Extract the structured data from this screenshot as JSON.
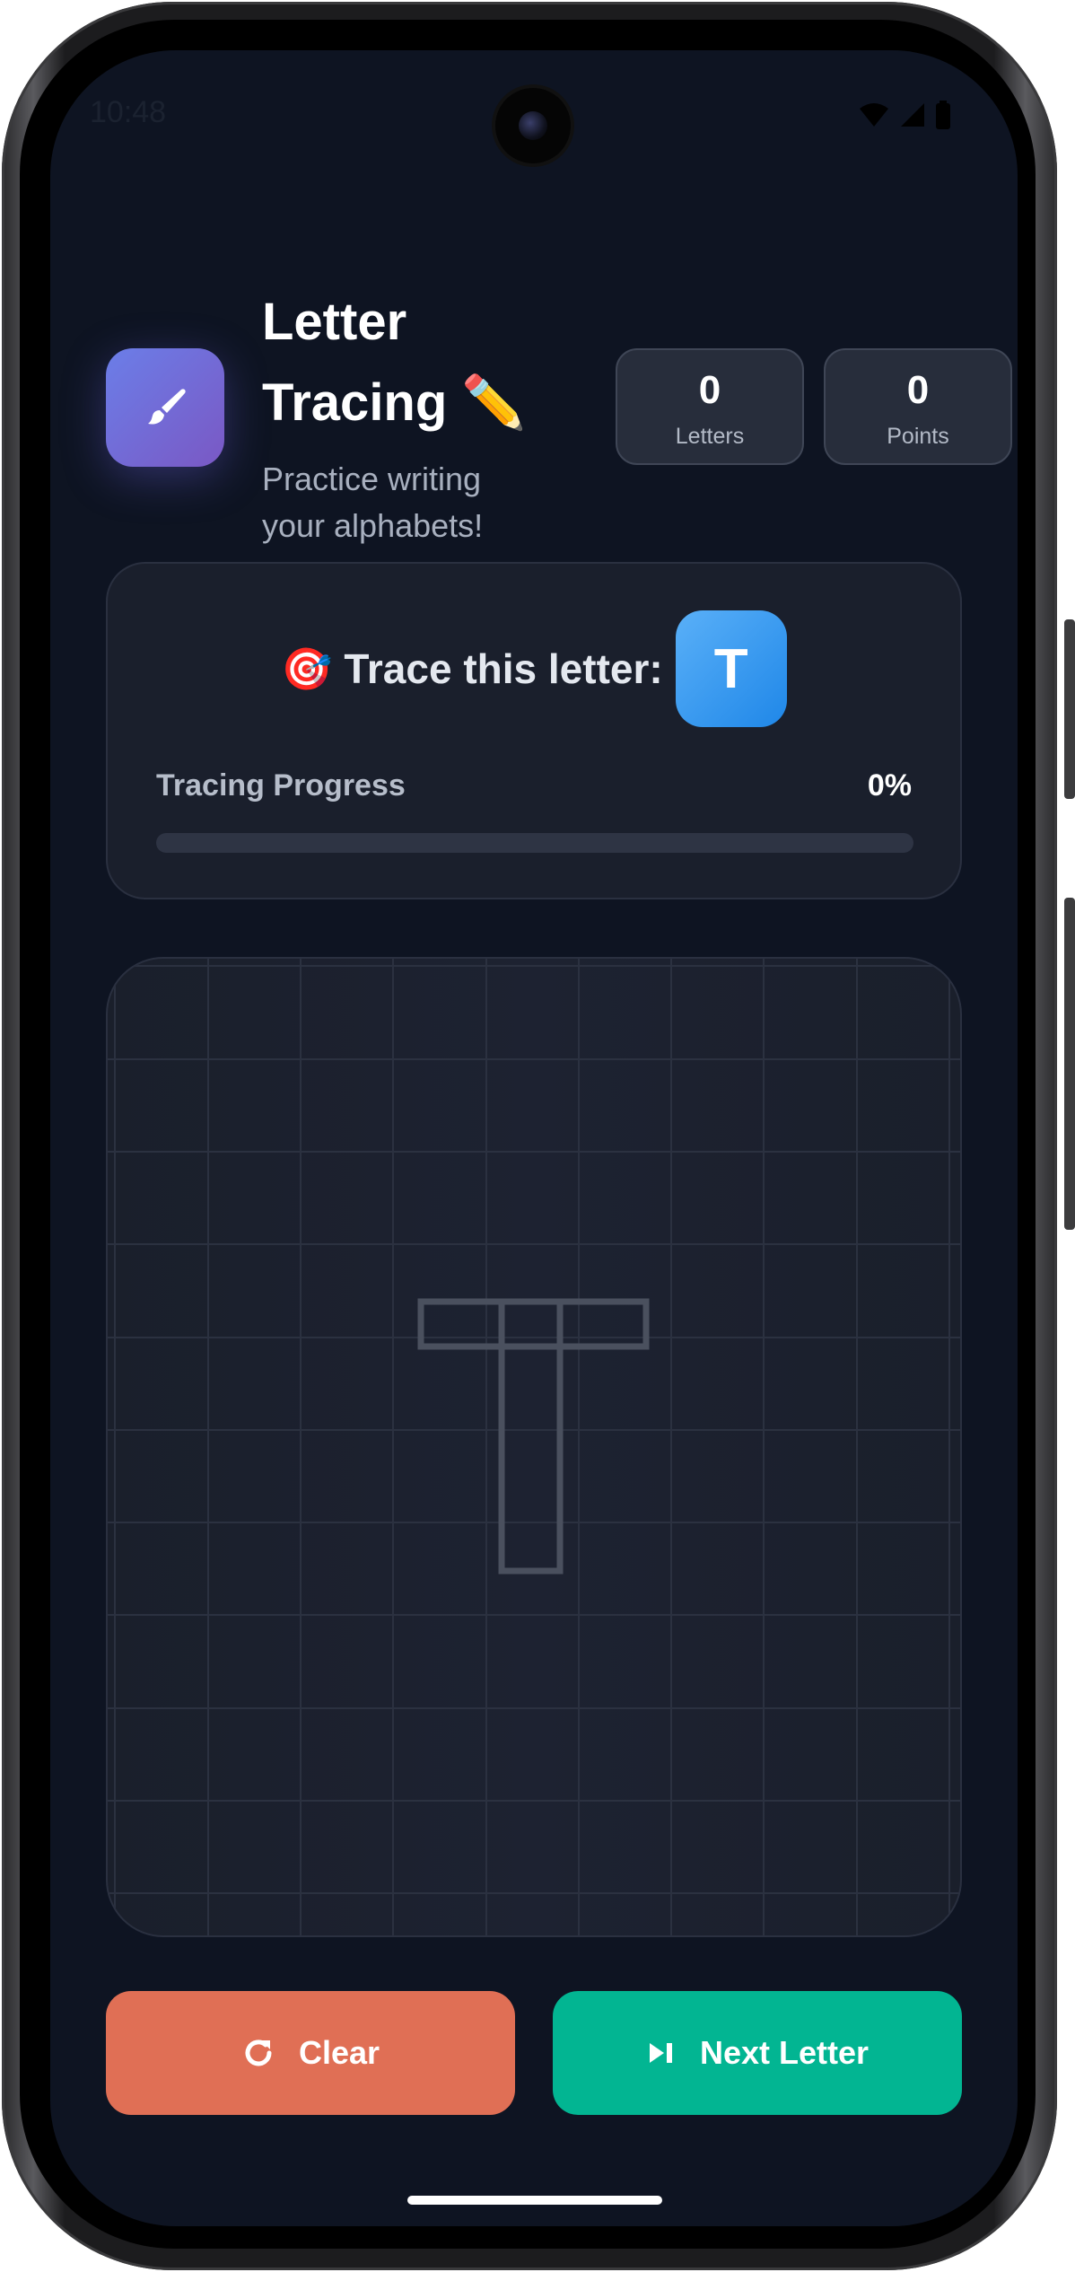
{
  "status_bar": {
    "time": "10:48",
    "icons": [
      "wifi-icon",
      "cell-signal-icon",
      "battery-icon"
    ]
  },
  "header": {
    "app_icon": "paintbrush-icon",
    "title_line1": "Letter",
    "title_line2": "Tracing ✏️",
    "subtitle": "Practice writing your alphabets!",
    "stats": [
      {
        "value": "0",
        "label": "Letters"
      },
      {
        "value": "0",
        "label": "Points"
      }
    ]
  },
  "trace": {
    "prompt": "🎯 Trace this letter:",
    "letter": "T",
    "progress_label": "Tracing Progress",
    "progress_value": "0%",
    "progress_fraction": 0
  },
  "canvas": {
    "guide_letter": "T",
    "grid": true
  },
  "actions": {
    "clear_label": "Clear",
    "clear_icon": "refresh-icon",
    "next_label": "Next Letter",
    "next_icon": "skip-next-icon"
  },
  "colors": {
    "background": "#0e1422",
    "card": "#1a1f2c",
    "app_icon_gradient": [
      "#6b7ee8",
      "#7a58c4"
    ],
    "letter_badge_gradient": [
      "#5ab0f8",
      "#1f87e8"
    ],
    "clear_button": "#e06f55",
    "next_button": "#02b592"
  }
}
